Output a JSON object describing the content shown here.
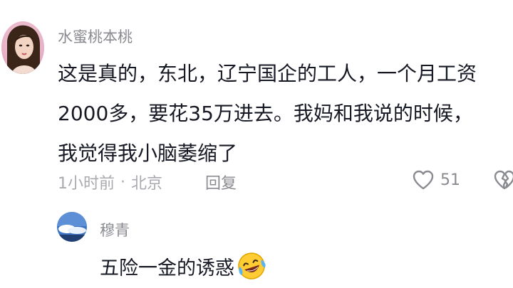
{
  "comment": {
    "username": "水蜜桃本桃",
    "content_lines": [
      "这是真的，东北，辽宁国企的工人，一个月工资",
      "2000多，要花35万进去。我妈和我说的时候，",
      "我觉得我小脑萎缩了"
    ],
    "time": "1小时前",
    "separator": "·",
    "location": "北京",
    "reply_label": "回复",
    "like_count": "51",
    "icons": {
      "like": "heart-outline-icon",
      "dislike": "broken-heart-icon"
    }
  },
  "reply": {
    "username": "穆青",
    "content": "五险一金的诱惑",
    "emoji": "laughing-crying-emoji"
  }
}
